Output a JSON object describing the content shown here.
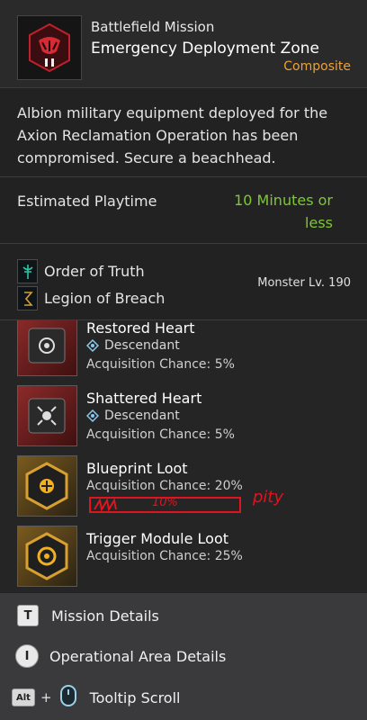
{
  "header": {
    "kicker": "Battlefield Mission",
    "title": "Emergency Deployment Zone",
    "tag": "Composite"
  },
  "description": "Albion military equipment deployed for the Axion Reclamation Operation has been compromised. Secure a beachhead.",
  "playtime": {
    "label": "Estimated Playtime",
    "value": "10 Minutes or less"
  },
  "factions": [
    {
      "name": "Order of Truth",
      "icon": "order-of-truth-icon"
    },
    {
      "name": "Legion of Breach",
      "icon": "legion-of-breach-icon"
    }
  ],
  "monster_level": "Monster Lv. 190",
  "rewards": [
    {
      "name": "Restored Heart",
      "type": "Descendant",
      "chance": "Acquisition Chance: 5%"
    },
    {
      "name": "Shattered Heart",
      "type": "Descendant",
      "chance": "Acquisition Chance: 5%"
    },
    {
      "name": "Blueprint Loot",
      "chance": "Acquisition Chance: 20%"
    },
    {
      "name": "Trigger Module Loot",
      "chance": "Acquisition Chance: 25%"
    }
  ],
  "annotation": {
    "box_text": "10%",
    "note": "pity"
  },
  "footer": [
    {
      "key": "T",
      "label": "Mission Details"
    },
    {
      "key": "I",
      "label": "Operational Area Details"
    },
    {
      "key": "Alt",
      "plus": "+",
      "label": "Tooltip Scroll"
    }
  ],
  "colors": {
    "accent_orange": "#f0a030",
    "playtime_green": "#7ec832",
    "annotation_red": "#e0141e"
  }
}
